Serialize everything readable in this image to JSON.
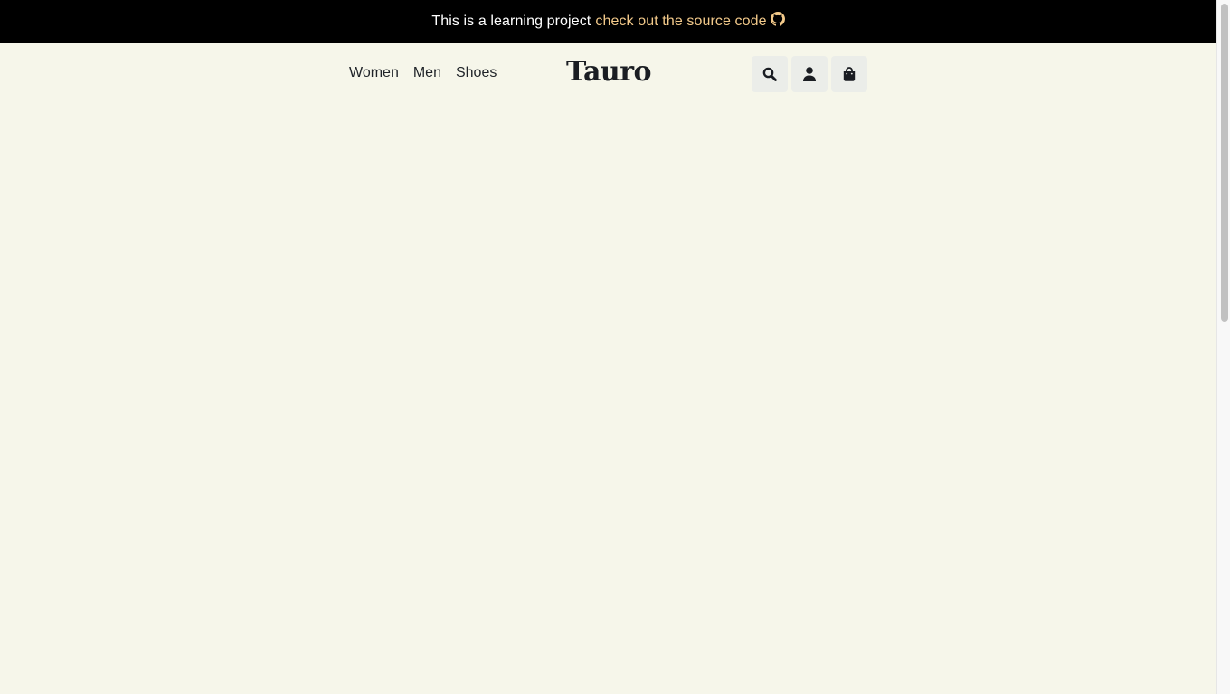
{
  "announcement": {
    "message": "This is a learning project",
    "link_text": "check out the source code",
    "link_icon": "github-icon"
  },
  "nav": {
    "items": [
      {
        "label": "Women"
      },
      {
        "label": "Men"
      },
      {
        "label": "Shoes"
      }
    ]
  },
  "brand": {
    "logo_text": "Tauro"
  },
  "actions": {
    "search_icon": "search-icon",
    "account_icon": "user-icon",
    "cart_icon": "shopping-bag-icon"
  },
  "colors": {
    "page_background": "#f6f6ea",
    "announcement_background": "#000000",
    "link_accent": "#f2c98a",
    "icon_button_background": "#ebede9",
    "text": "#1f2328"
  }
}
